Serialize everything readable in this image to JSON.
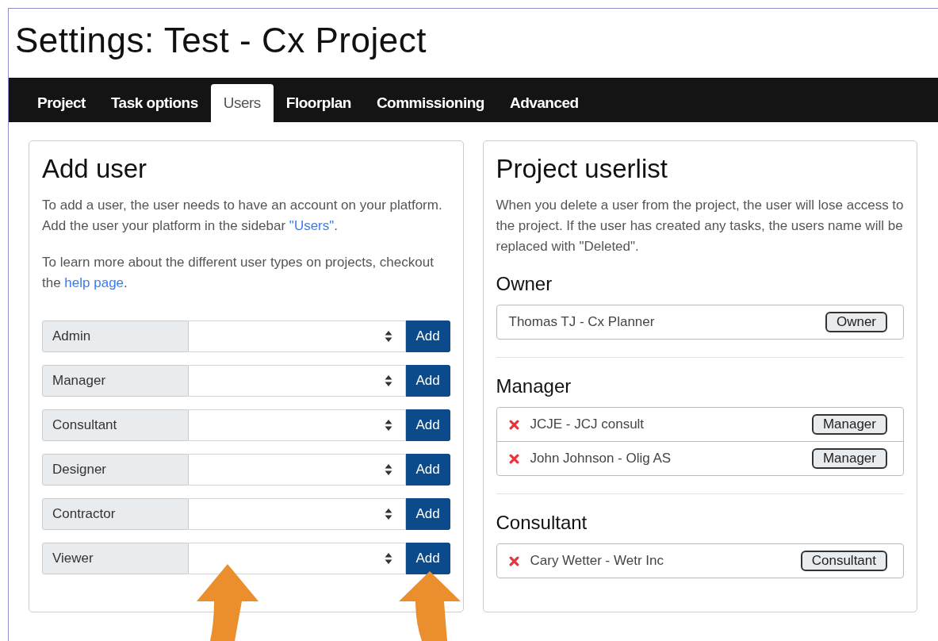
{
  "title": "Settings: Test - Cx Project",
  "tabs": [
    {
      "label": "Project",
      "selected": false
    },
    {
      "label": "Task options",
      "selected": false
    },
    {
      "label": "Users",
      "selected": true
    },
    {
      "label": "Floorplan",
      "selected": false
    },
    {
      "label": "Commissioning",
      "selected": false
    },
    {
      "label": "Advanced",
      "selected": false
    }
  ],
  "add_user": {
    "heading": "Add user",
    "paragraphs": [
      {
        "before": "To add a user, the user needs to have an account on your platform. Add the user your platform in the sidebar ",
        "link": "\"Users\"",
        "after": "."
      },
      {
        "before": "To learn more about the different user types on projects, checkout the ",
        "link": "help page",
        "after": "."
      }
    ],
    "rows": [
      {
        "label": "Admin",
        "button": "Add"
      },
      {
        "label": "Manager",
        "button": "Add"
      },
      {
        "label": "Consultant",
        "button": "Add"
      },
      {
        "label": "Designer",
        "button": "Add"
      },
      {
        "label": "Contractor",
        "button": "Add"
      },
      {
        "label": "Viewer",
        "button": "Add"
      }
    ]
  },
  "userlist": {
    "heading": "Project userlist",
    "description": "When you delete a user from the project, the user will lose access to the project. If the user has created any tasks, the users name will be replaced with \"Deleted\".",
    "groups": [
      {
        "heading": "Owner",
        "users": [
          {
            "name": "Thomas TJ - Cx Planner",
            "role": "Owner",
            "removable": false
          }
        ]
      },
      {
        "heading": "Manager",
        "users": [
          {
            "name": "JCJE - JCJ consult",
            "role": "Manager",
            "removable": true
          },
          {
            "name": "John Johnson - Olig AS",
            "role": "Manager",
            "removable": true
          }
        ]
      },
      {
        "heading": "Consultant",
        "users": [
          {
            "name": "Cary Wetter - Wetr Inc",
            "role": "Consultant",
            "removable": true
          }
        ]
      }
    ]
  }
}
